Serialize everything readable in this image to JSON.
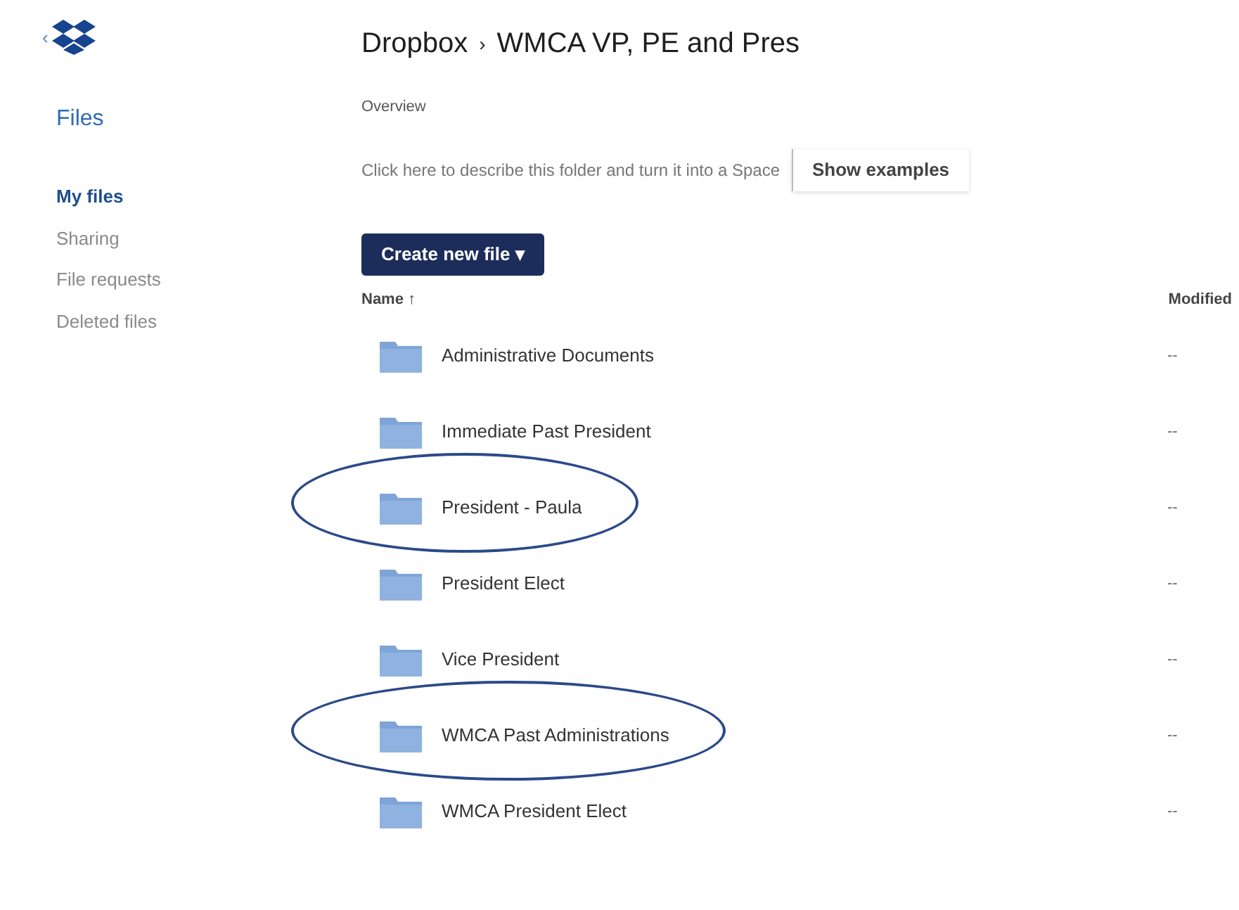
{
  "sidebar": {
    "back": "‹",
    "title": "Files",
    "items": [
      {
        "label": "My files",
        "selected": true
      },
      {
        "label": "Sharing",
        "selected": false
      },
      {
        "label": "File requests",
        "selected": false
      },
      {
        "label": "Deleted files",
        "selected": false
      }
    ]
  },
  "breadcrumb": {
    "root": "Dropbox",
    "separator": "›",
    "current": "WMCA VP, PE and Pres"
  },
  "overview": "Overview",
  "description": "Click here to describe this folder and turn it into a Space",
  "show_examples": "Show examples",
  "create_button": {
    "label": "Create new file",
    "caret": "▾"
  },
  "table": {
    "columns": [
      {
        "label": "Name",
        "sort": "↑"
      },
      {
        "label": "Modified"
      }
    ],
    "rows": [
      {
        "name": "Administrative Documents",
        "modified": "--",
        "circled": false
      },
      {
        "name": "Immediate Past President",
        "modified": "--",
        "circled": false
      },
      {
        "name": "President - Paula",
        "modified": "--",
        "circled": true
      },
      {
        "name": "President Elect",
        "modified": "--",
        "circled": false
      },
      {
        "name": "Vice President",
        "modified": "--",
        "circled": false
      },
      {
        "name": "WMCA Past Administrations",
        "modified": "--",
        "circled": true
      },
      {
        "name": "WMCA President Elect",
        "modified": "--",
        "circled": false
      }
    ]
  }
}
